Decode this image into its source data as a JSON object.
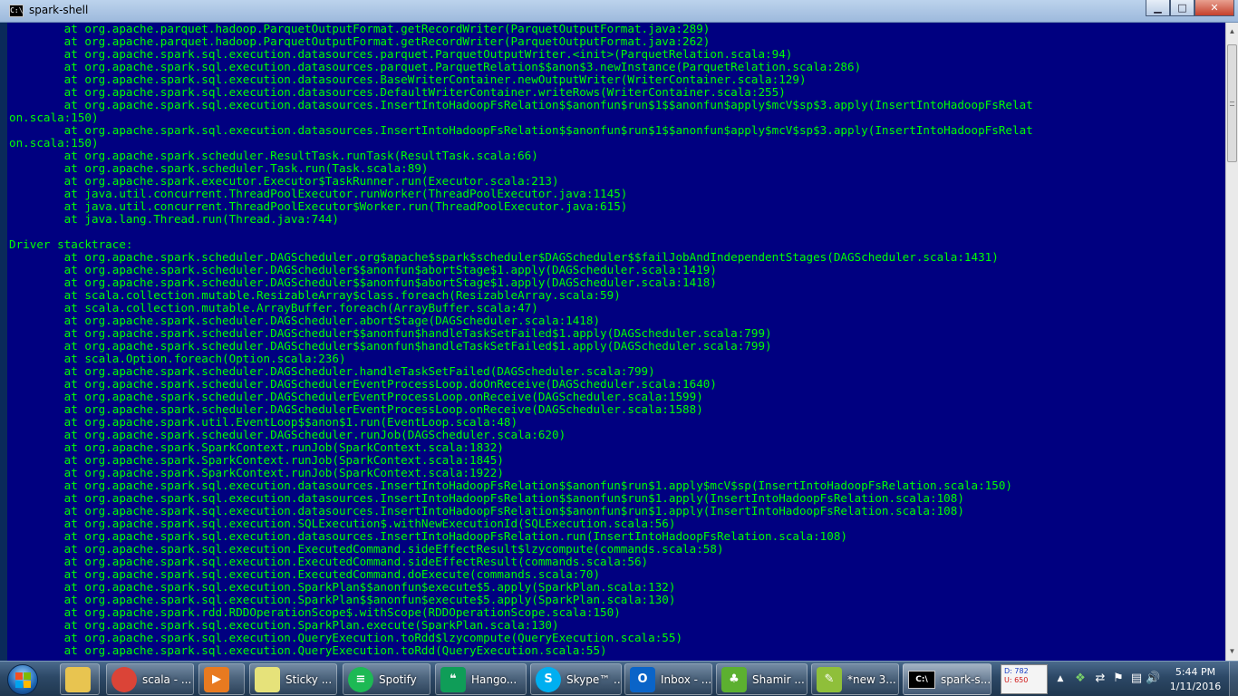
{
  "window": {
    "title": "spark-shell",
    "app_icon": "C:\\",
    "minimize": "▁",
    "maximize": "□",
    "close": "✕"
  },
  "console": {
    "background": "#000080",
    "foreground": "#00ff00",
    "lines": [
      "        at org.apache.parquet.hadoop.ParquetOutputFormat.getRecordWriter(ParquetOutputFormat.java:289)",
      "        at org.apache.parquet.hadoop.ParquetOutputFormat.getRecordWriter(ParquetOutputFormat.java:262)",
      "        at org.apache.spark.sql.execution.datasources.parquet.ParquetOutputWriter.<init>(ParquetRelation.scala:94)",
      "        at org.apache.spark.sql.execution.datasources.parquet.ParquetRelation$$anon$3.newInstance(ParquetRelation.scala:286)",
      "        at org.apache.spark.sql.execution.datasources.BaseWriterContainer.newOutputWriter(WriterContainer.scala:129)",
      "        at org.apache.spark.sql.execution.datasources.DefaultWriterContainer.writeRows(WriterContainer.scala:255)",
      "        at org.apache.spark.sql.execution.datasources.InsertIntoHadoopFsRelation$$anonfun$run$1$$anonfun$apply$mcV$sp$3.apply(InsertIntoHadoopFsRelat",
      "on.scala:150)",
      "        at org.apache.spark.sql.execution.datasources.InsertIntoHadoopFsRelation$$anonfun$run$1$$anonfun$apply$mcV$sp$3.apply(InsertIntoHadoopFsRelat",
      "on.scala:150)",
      "        at org.apache.spark.scheduler.ResultTask.runTask(ResultTask.scala:66)",
      "        at org.apache.spark.scheduler.Task.run(Task.scala:89)",
      "        at org.apache.spark.executor.Executor$TaskRunner.run(Executor.scala:213)",
      "        at java.util.concurrent.ThreadPoolExecutor.runWorker(ThreadPoolExecutor.java:1145)",
      "        at java.util.concurrent.ThreadPoolExecutor$Worker.run(ThreadPoolExecutor.java:615)",
      "        at java.lang.Thread.run(Thread.java:744)",
      "",
      "Driver stacktrace:",
      "        at org.apache.spark.scheduler.DAGScheduler.org$apache$spark$scheduler$DAGScheduler$$failJobAndIndependentStages(DAGScheduler.scala:1431)",
      "        at org.apache.spark.scheduler.DAGScheduler$$anonfun$abortStage$1.apply(DAGScheduler.scala:1419)",
      "        at org.apache.spark.scheduler.DAGScheduler$$anonfun$abortStage$1.apply(DAGScheduler.scala:1418)",
      "        at scala.collection.mutable.ResizableArray$class.foreach(ResizableArray.scala:59)",
      "        at scala.collection.mutable.ArrayBuffer.foreach(ArrayBuffer.scala:47)",
      "        at org.apache.spark.scheduler.DAGScheduler.abortStage(DAGScheduler.scala:1418)",
      "        at org.apache.spark.scheduler.DAGScheduler$$anonfun$handleTaskSetFailed$1.apply(DAGScheduler.scala:799)",
      "        at org.apache.spark.scheduler.DAGScheduler$$anonfun$handleTaskSetFailed$1.apply(DAGScheduler.scala:799)",
      "        at scala.Option.foreach(Option.scala:236)",
      "        at org.apache.spark.scheduler.DAGScheduler.handleTaskSetFailed(DAGScheduler.scala:799)",
      "        at org.apache.spark.scheduler.DAGSchedulerEventProcessLoop.doOnReceive(DAGScheduler.scala:1640)",
      "        at org.apache.spark.scheduler.DAGSchedulerEventProcessLoop.onReceive(DAGScheduler.scala:1599)",
      "        at org.apache.spark.scheduler.DAGSchedulerEventProcessLoop.onReceive(DAGScheduler.scala:1588)",
      "        at org.apache.spark.util.EventLoop$$anon$1.run(EventLoop.scala:48)",
      "        at org.apache.spark.scheduler.DAGScheduler.runJob(DAGScheduler.scala:620)",
      "        at org.apache.spark.SparkContext.runJob(SparkContext.scala:1832)",
      "        at org.apache.spark.SparkContext.runJob(SparkContext.scala:1845)",
      "        at org.apache.spark.SparkContext.runJob(SparkContext.scala:1922)",
      "        at org.apache.spark.sql.execution.datasources.InsertIntoHadoopFsRelation$$anonfun$run$1.apply$mcV$sp(InsertIntoHadoopFsRelation.scala:150)",
      "        at org.apache.spark.sql.execution.datasources.InsertIntoHadoopFsRelation$$anonfun$run$1.apply(InsertIntoHadoopFsRelation.scala:108)",
      "        at org.apache.spark.sql.execution.datasources.InsertIntoHadoopFsRelation$$anonfun$run$1.apply(InsertIntoHadoopFsRelation.scala:108)",
      "        at org.apache.spark.sql.execution.SQLExecution$.withNewExecutionId(SQLExecution.scala:56)",
      "        at org.apache.spark.sql.execution.datasources.InsertIntoHadoopFsRelation.run(InsertIntoHadoopFsRelation.scala:108)",
      "        at org.apache.spark.sql.execution.ExecutedCommand.sideEffectResult$lzycompute(commands.scala:58)",
      "        at org.apache.spark.sql.execution.ExecutedCommand.sideEffectResult(commands.scala:56)",
      "        at org.apache.spark.sql.execution.ExecutedCommand.doExecute(commands.scala:70)",
      "        at org.apache.spark.sql.execution.SparkPlan$$anonfun$execute$5.apply(SparkPlan.scala:132)",
      "        at org.apache.spark.sql.execution.SparkPlan$$anonfun$execute$5.apply(SparkPlan.scala:130)",
      "        at org.apache.spark.rdd.RDDOperationScope$.withScope(RDDOperationScope.scala:150)",
      "        at org.apache.spark.sql.execution.SparkPlan.execute(SparkPlan.scala:130)",
      "        at org.apache.spark.sql.execution.QueryExecution.toRdd$lzycompute(QueryExecution.scala:55)",
      "        at org.apache.spark.sql.execution.QueryExecution.toRdd(QueryExecution.scala:55)"
    ]
  },
  "taskbar": {
    "items": [
      {
        "name": "explorer",
        "icon": "folder-icon",
        "label": "",
        "glyph": "",
        "color": "#e8c450"
      },
      {
        "name": "chrome",
        "icon": "chrome-icon",
        "label": "scala - ...",
        "glyph": "",
        "color": "#db4437"
      },
      {
        "name": "media",
        "icon": "media-player-icon",
        "label": "",
        "glyph": "▶",
        "color": "#e87a20"
      },
      {
        "name": "sticky",
        "icon": "sticky-notes-icon",
        "label": "Sticky ...",
        "glyph": "",
        "color": "#e6e27a"
      },
      {
        "name": "spotify",
        "icon": "spotify-icon",
        "label": "Spotify",
        "glyph": "≡",
        "color": "#1db954"
      },
      {
        "name": "hangouts",
        "icon": "hangouts-icon",
        "label": "Hango...",
        "glyph": "❝",
        "color": "#0f9d58"
      },
      {
        "name": "skype",
        "icon": "skype-icon",
        "label": "Skype™ ...",
        "glyph": "S",
        "color": "#00aff0"
      },
      {
        "name": "outlook",
        "icon": "outlook-icon",
        "label": "Inbox - ...",
        "glyph": "O",
        "color": "#0a64c8"
      },
      {
        "name": "shamir",
        "icon": "clover-icon",
        "label": "Shamir ...",
        "glyph": "♣",
        "color": "#5cb030"
      },
      {
        "name": "notepad",
        "icon": "notepad-plus-icon",
        "label": "*new 3...",
        "glyph": "✎",
        "color": "#8fbf3a"
      },
      {
        "name": "cmd",
        "icon": "cmd-icon",
        "label": "spark-s...",
        "glyph": "C:\\",
        "color": "#000000"
      }
    ],
    "meter": {
      "download": "D: 782",
      "upload": "U: 650"
    },
    "tray_icons": [
      "show-hidden-icon",
      "dropbox-icon",
      "network-share-icon",
      "flag-icon",
      "network-icon",
      "volume-icon"
    ],
    "tray_glyphs": [
      "▲",
      "❖",
      "⇄",
      "⚑",
      "▤",
      "🔊"
    ],
    "clock": {
      "time": "5:44 PM",
      "date": "1/11/2016"
    }
  }
}
